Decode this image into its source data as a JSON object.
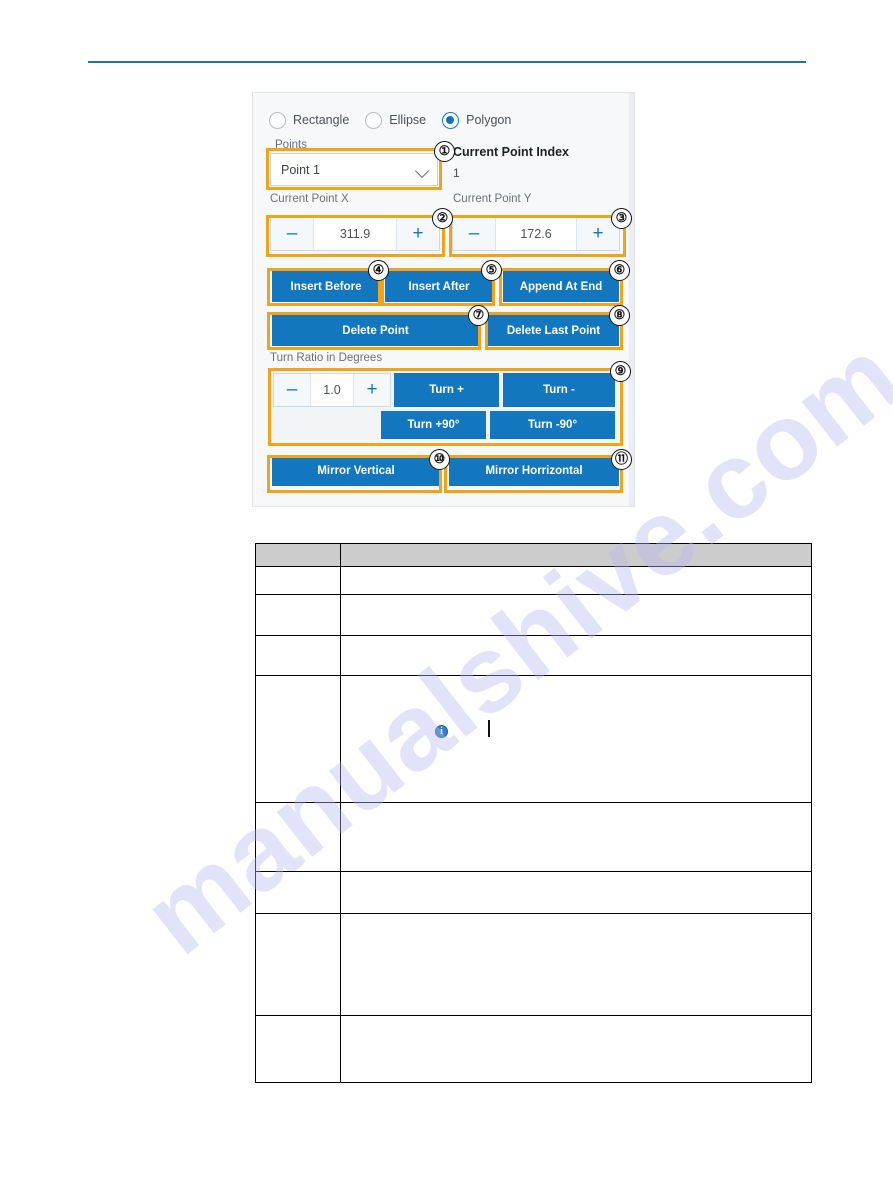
{
  "page": {
    "watermark_text": "manualshive.com"
  },
  "panel": {
    "shape_radios": [
      {
        "label": "Rectangle",
        "checked": false
      },
      {
        "label": "Ellipse",
        "checked": false
      },
      {
        "label": "Polygon",
        "checked": true
      }
    ],
    "points_group_label": "Points",
    "points_dropdown": {
      "value": "Point 1",
      "icon": "chevron-down-icon"
    },
    "current_point_index": {
      "label": "Current Point Index",
      "value": "1"
    },
    "current_point_x": {
      "label": "Current Point X",
      "value": "311.9",
      "minus": "–",
      "plus": "+"
    },
    "current_point_y": {
      "label": "Current Point Y",
      "value": "172.6",
      "minus": "–",
      "plus": "+"
    },
    "buttons": {
      "insert_before": "Insert Before",
      "insert_after": "Insert After",
      "append_at_end": "Append At End",
      "delete_point": "Delete Point",
      "delete_last_point": "Delete Last Point",
      "turn_plus": "Turn +",
      "turn_minus": "Turn -",
      "turn_plus_90": "Turn +90°",
      "turn_minus_90": "Turn -90°",
      "mirror_vertical": "Mirror Vertical",
      "mirror_horizontal": "Mirror Horrizontal"
    },
    "turn_ratio": {
      "label": "Turn Ratio in Degrees",
      "value": "1.0",
      "minus": "–",
      "plus": "+"
    }
  },
  "callouts": [
    {
      "n": "①"
    },
    {
      "n": "②"
    },
    {
      "n": "③"
    },
    {
      "n": "④"
    },
    {
      "n": "⑤"
    },
    {
      "n": "⑥"
    },
    {
      "n": "⑦"
    },
    {
      "n": "⑧"
    },
    {
      "n": "⑨"
    },
    {
      "n": "⑩"
    },
    {
      "n": "⑪"
    }
  ],
  "table": {
    "header": {
      "col_a": "",
      "col_b": ""
    },
    "rows": [
      {
        "col_a": "",
        "col_b": ""
      },
      {
        "col_a": "",
        "col_b": ""
      },
      {
        "col_a": "",
        "col_b": ""
      },
      {
        "col_a": "",
        "col_b": ""
      },
      {
        "col_a": "",
        "col_b": ""
      },
      {
        "col_a": "",
        "col_b": ""
      },
      {
        "col_a": "",
        "col_b": ""
      },
      {
        "col_a": "",
        "col_b": ""
      }
    ],
    "note_icon": "info-icon"
  },
  "colors": {
    "button_blue": "#1377c0",
    "highlight_orange": "#f2a317",
    "rule_teal": "#1b7a8e",
    "radio_blue": "#0f72c4",
    "table_header_grey": "#cccccc"
  }
}
